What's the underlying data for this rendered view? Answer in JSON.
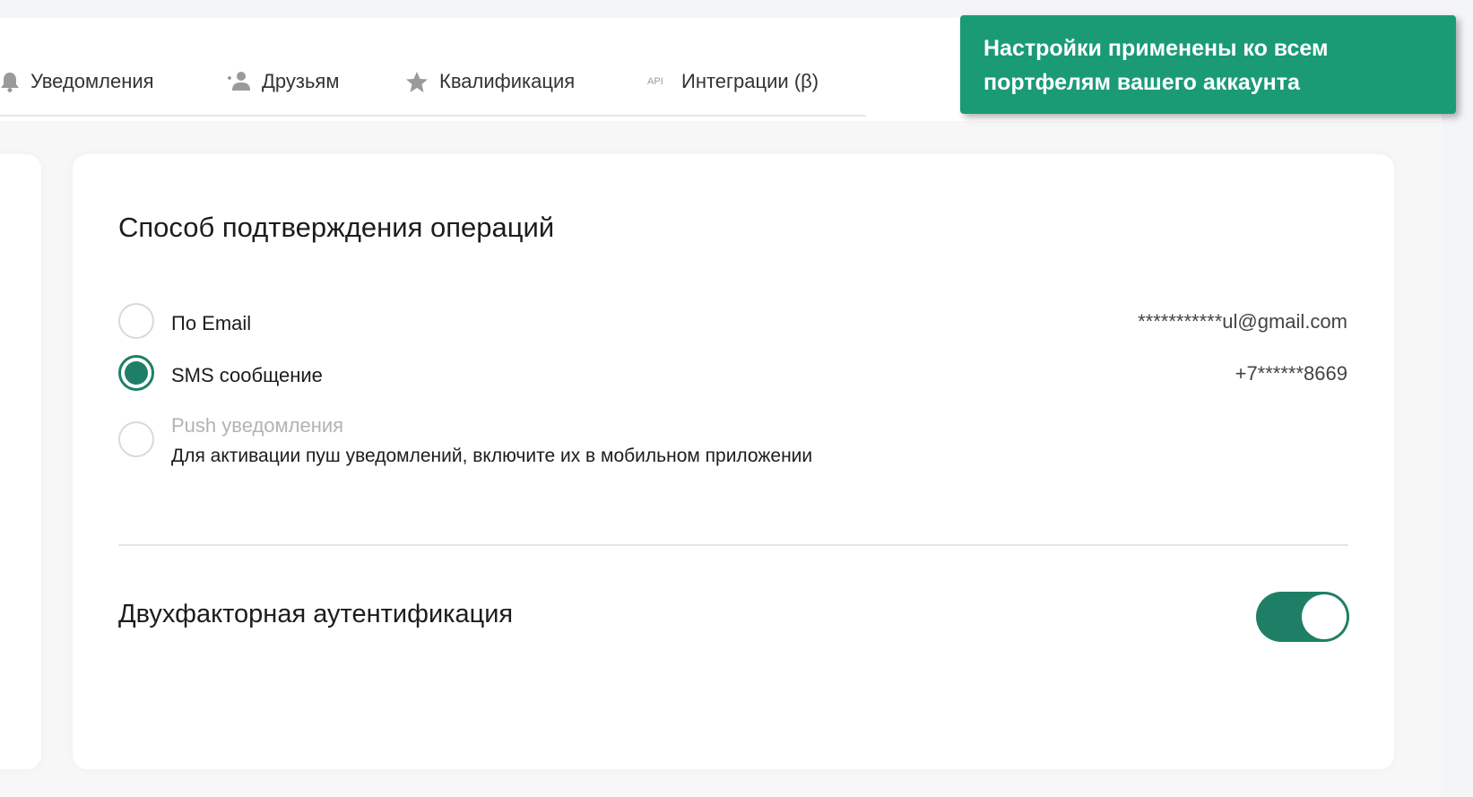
{
  "tabs": {
    "notifications": {
      "label": "Уведомления",
      "icon": "bell-icon"
    },
    "friends": {
      "label": "Друзьям",
      "icon": "add-person-icon"
    },
    "qualification": {
      "label": "Квалификация",
      "icon": "star-icon"
    },
    "integrations": {
      "label": "Интеграции (β)",
      "icon": "api-icon",
      "icon_text": "API"
    }
  },
  "confirmation": {
    "title": "Способ подтверждения операций",
    "options": [
      {
        "label": "По Email",
        "value": "***********ul@gmail.com",
        "selected": false
      },
      {
        "label": "SMS сообщение",
        "value": "+7******8669",
        "selected": true
      },
      {
        "label": "Push уведомления",
        "hint": "Для активации пуш уведомлений, включите их в мобильном приложении",
        "selected": false,
        "disabled": true
      }
    ]
  },
  "two_factor": {
    "title": "Двухфакторная аутентификация",
    "enabled": true
  },
  "toast": {
    "line1": "Настройки применены ко всем",
    "line2": "портфелям вашего аккаунта"
  },
  "colors": {
    "accent": "#1f7f66",
    "toast_bg": "#1a9b76"
  }
}
